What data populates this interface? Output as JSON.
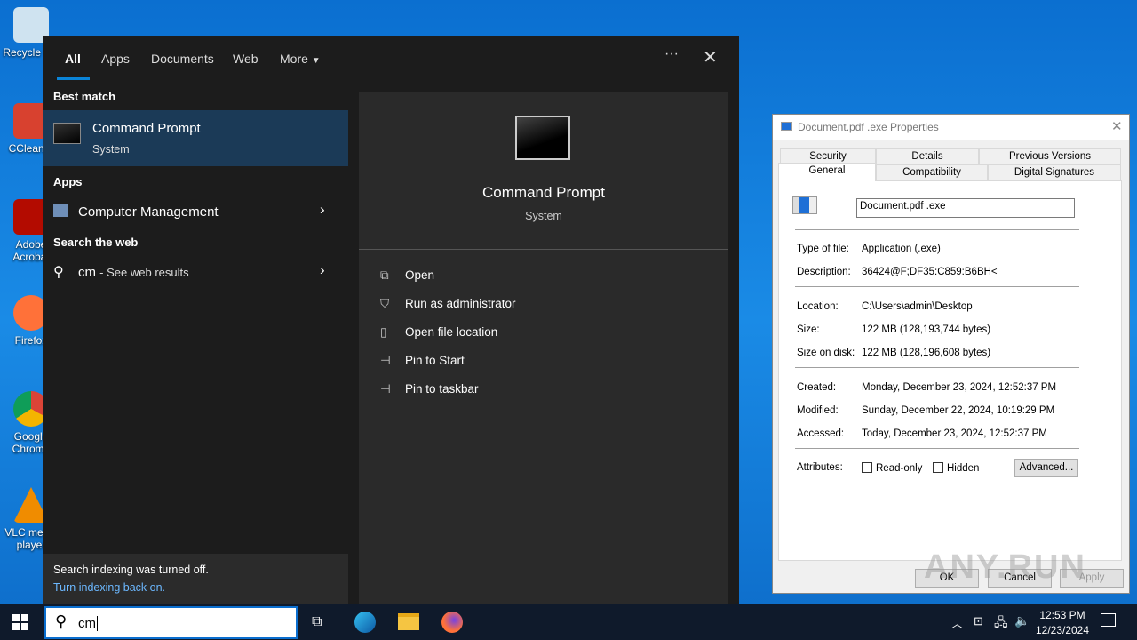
{
  "desktop": {
    "icons": [
      "Recycle Bin",
      "CCleaner",
      "Adobe Acrobat",
      "Firefox",
      "Google Chrome",
      "VLC media player"
    ]
  },
  "search": {
    "tabs": [
      "All",
      "Apps",
      "Documents",
      "Web",
      "More"
    ],
    "best_match_heading": "Best match",
    "best_match": {
      "title": "Command Prompt",
      "subtitle": "System"
    },
    "apps_heading": "Apps",
    "apps": [
      {
        "title": "Computer Management"
      }
    ],
    "web_heading": "Search the web",
    "web": {
      "query": "cm",
      "suffix": "- See web results"
    },
    "preview": {
      "title": "Command Prompt",
      "subtitle": "System"
    },
    "actions": [
      "Open",
      "Run as administrator",
      "Open file location",
      "Pin to Start",
      "Pin to taskbar"
    ],
    "footer": {
      "text": "Search indexing was turned off.",
      "link": "Turn indexing back on."
    },
    "input_value": "cm"
  },
  "properties": {
    "title": "Document.pdf .exe Properties",
    "tabs_row1": [
      "Security",
      "Details",
      "Previous Versions"
    ],
    "tabs_row2": [
      "General",
      "Compatibility",
      "Digital Signatures"
    ],
    "filename": "Document.pdf .exe",
    "fields": [
      {
        "label": "Type of file:",
        "value": "Application (.exe)"
      },
      {
        "label": "Description:",
        "value": "36424@F;DF35:C859:B6BH<"
      },
      {
        "label": "Location:",
        "value": "C:\\Users\\admin\\Desktop"
      },
      {
        "label": "Size:",
        "value": "122 MB (128,193,744 bytes)"
      },
      {
        "label": "Size on disk:",
        "value": "122 MB (128,196,608 bytes)"
      },
      {
        "label": "Created:",
        "value": "Monday, December 23, 2024, 12:52:37 PM"
      },
      {
        "label": "Modified:",
        "value": "Sunday, December 22, 2024, 10:19:29 PM"
      },
      {
        "label": "Accessed:",
        "value": "Today, December 23, 2024, 12:52:37 PM"
      }
    ],
    "attributes_label": "Attributes:",
    "readonly": "Read-only",
    "hidden": "Hidden",
    "advanced": "Advanced...",
    "ok": "OK",
    "cancel": "Cancel",
    "apply": "Apply"
  },
  "tray": {
    "time": "12:53 PM",
    "date": "12/23/2024"
  },
  "watermark": "ANY.RUN"
}
